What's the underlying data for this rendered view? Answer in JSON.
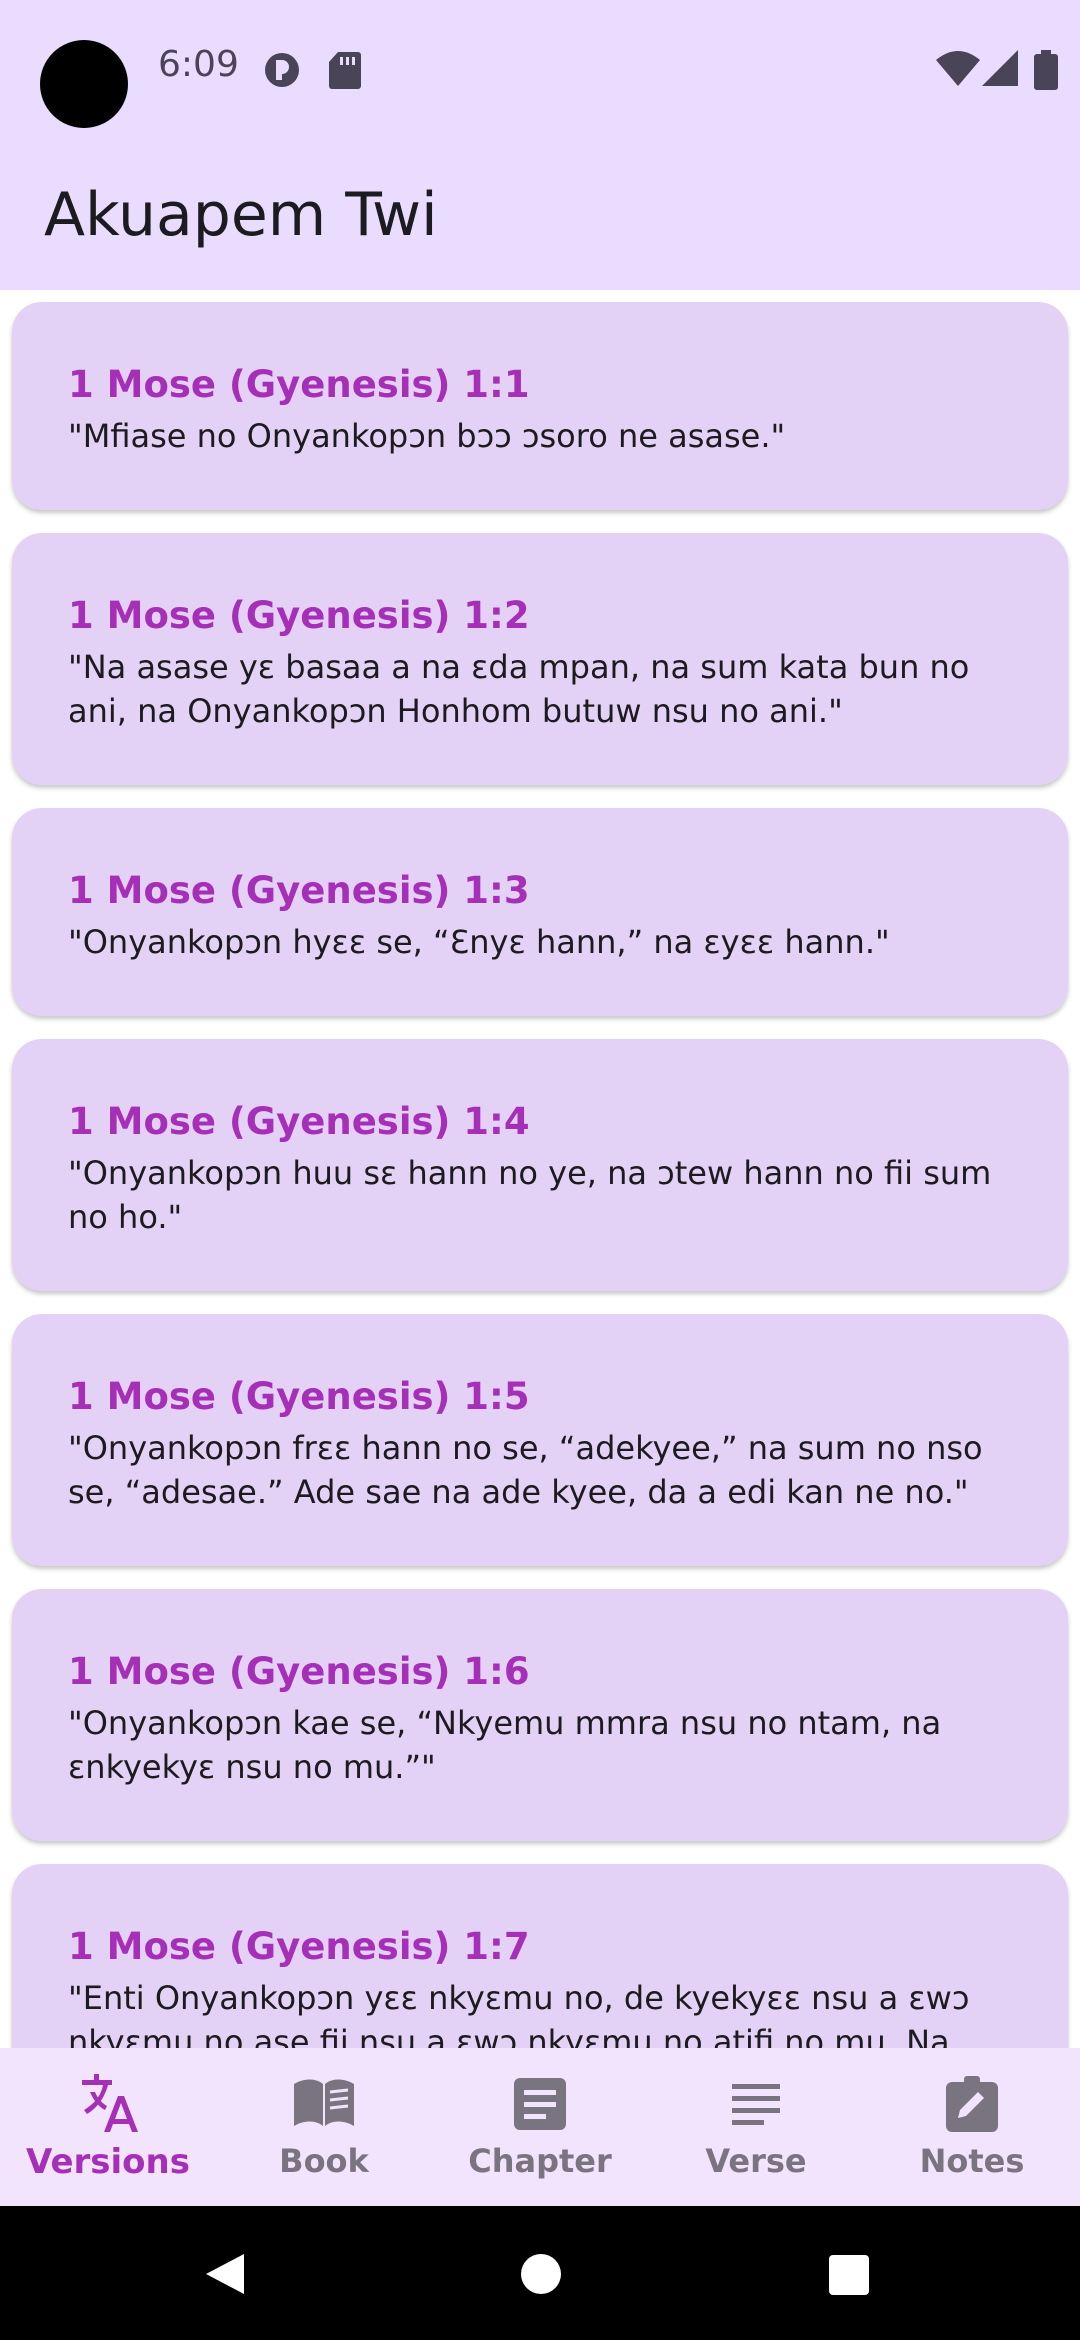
{
  "status": {
    "time": "6:09",
    "icons": [
      "data-saver-icon",
      "sd-card-icon",
      "wifi-icon",
      "signal-icon",
      "battery-icon"
    ]
  },
  "app": {
    "title": "Akuapem Twi"
  },
  "verses": [
    {
      "ref": "1 Mose (Gyenesis) 1:1",
      "text": "\"Mfiase no Onyankopɔn bɔɔ ɔsoro ne asase.\""
    },
    {
      "ref": "1 Mose (Gyenesis) 1:2",
      "text": "\"Na asase yɛ basaa a na ɛda mpan, na sum kata bun no ani, na Onyankopɔn Honhom butuw nsu no ani.\""
    },
    {
      "ref": "1 Mose (Gyenesis) 1:3",
      "text": "\"Onyankopɔn hyɛɛ se, “Ɛnyɛ hann,” na ɛyɛɛ hann.\""
    },
    {
      "ref": "1 Mose (Gyenesis) 1:4",
      "text": "\"Onyankopɔn huu sɛ hann no ye, na ɔtew hann no fii sum no ho.\""
    },
    {
      "ref": "1 Mose (Gyenesis) 1:5",
      "text": "\"Onyankopɔn frɛɛ hann no se, “adekyee,” na sum no nso se, “adesae.” Ade sae na ade kyee, da a edi kan ne no.\""
    },
    {
      "ref": "1 Mose (Gyenesis) 1:6",
      "text": "\"Onyankopɔn kae se, “Nkyemu mmra nsu no ntam, na ɛnkyekyɛ nsu no mu.”\""
    },
    {
      "ref": "1 Mose (Gyenesis) 1:7",
      "text": "\"Enti Onyankopɔn yɛɛ nkyɛmu no, de kyekyɛɛ nsu a ɛwɔ nkyɛmu no ase fii nsu a ɛwɔ nkyɛmu no atifi no mu. Na ɛyɛɛ"
    }
  ],
  "nav": {
    "items": [
      {
        "label": "Versions",
        "icon": "translate-icon",
        "active": true
      },
      {
        "label": "Book",
        "icon": "book-icon",
        "active": false
      },
      {
        "label": "Chapter",
        "icon": "article-icon",
        "active": false
      },
      {
        "label": "Verse",
        "icon": "lines-icon",
        "active": false
      },
      {
        "label": "Notes",
        "icon": "edit-note-icon",
        "active": false
      }
    ]
  },
  "colors": {
    "accent": "#a62fb8",
    "app_bar": "#eadcff",
    "card": "#e4d2f6",
    "nav_inactive": "#7a7480"
  }
}
